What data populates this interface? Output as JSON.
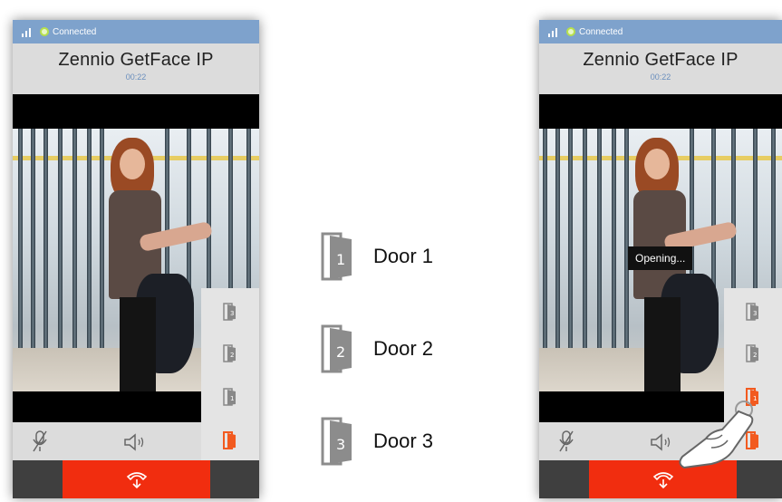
{
  "status": {
    "connection": "Connected"
  },
  "call": {
    "title": "Zennio GetFace IP",
    "timer": "00:22"
  },
  "overlay": {
    "opening": "Opening..."
  },
  "side_panel": {
    "doors": [
      "3",
      "2",
      "1"
    ],
    "active_color": "#f25a1f"
  },
  "legend": [
    {
      "number": "1",
      "label": "Door 1"
    },
    {
      "number": "2",
      "label": "Door 2"
    },
    {
      "number": "3",
      "label": "Door 3"
    }
  ],
  "colors": {
    "status_bar": "#7ea2cc",
    "hangup": "#f12d0f",
    "timer": "#6a8ebd"
  },
  "icons": {
    "signal": "signal-icon",
    "mic": "microphone-muted-icon",
    "speaker": "speaker-icon",
    "hangup": "hang-up-icon",
    "door": "door-icon",
    "hand": "hand-pointer-icon"
  }
}
